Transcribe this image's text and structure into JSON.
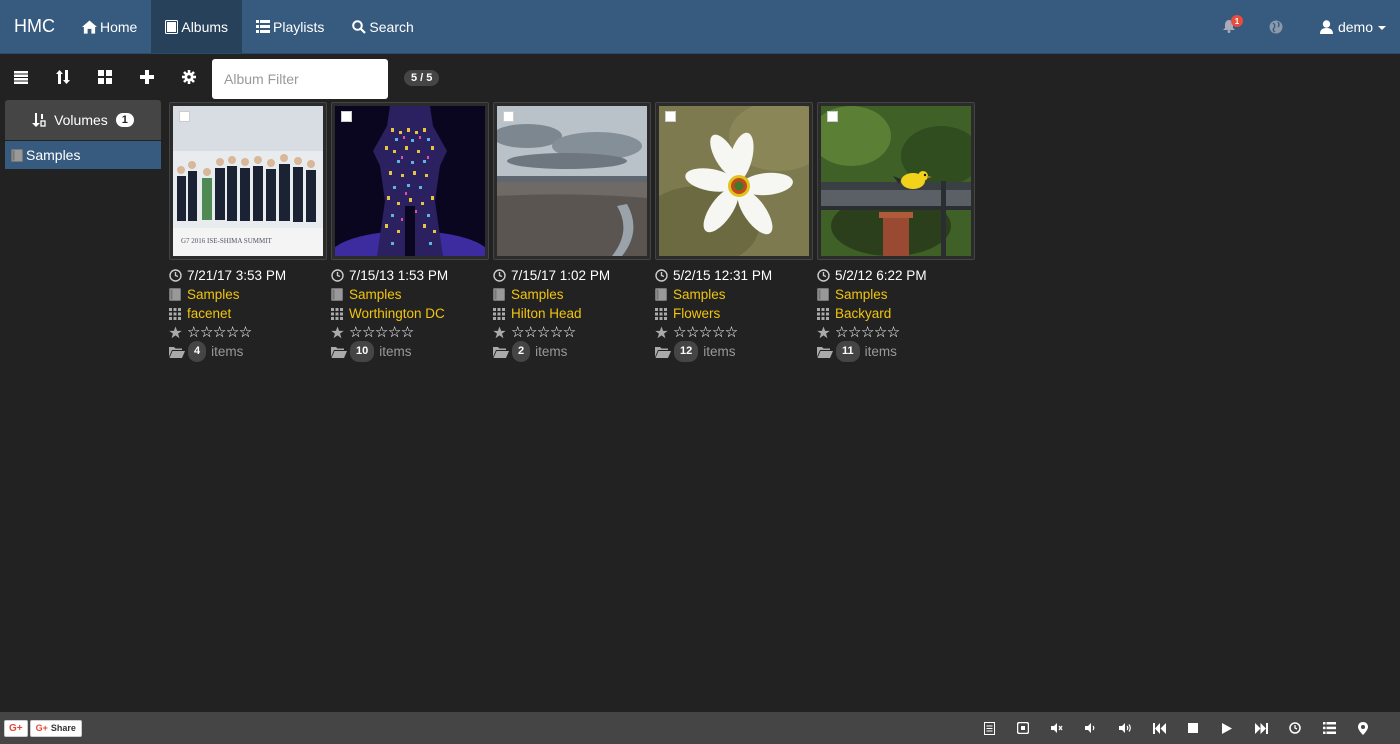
{
  "navbar": {
    "brand": "HMC",
    "items": [
      {
        "label": "Home",
        "icon": "home-icon"
      },
      {
        "label": "Albums",
        "icon": "album-icon",
        "active": true
      },
      {
        "label": "Playlists",
        "icon": "list-icon"
      },
      {
        "label": "Search",
        "icon": "search-icon"
      }
    ],
    "notifications": "1",
    "user": "demo"
  },
  "toolbar": {
    "filter_placeholder": "Album Filter",
    "count": "5 / 5"
  },
  "sidebar": {
    "header": "Volumes",
    "volume_count": "1",
    "volumes": [
      {
        "label": "Samples"
      }
    ]
  },
  "albums": [
    {
      "date": "7/21/17 3:53 PM",
      "volume": "Samples",
      "name": "facenet",
      "stars": "☆☆☆☆☆",
      "count": "4",
      "items_label": "items"
    },
    {
      "date": "7/15/13 1:53 PM",
      "volume": "Samples",
      "name": "Worthington DC",
      "stars": "☆☆☆☆☆",
      "count": "10",
      "items_label": "items"
    },
    {
      "date": "7/15/17 1:02 PM",
      "volume": "Samples",
      "name": "Hilton Head",
      "stars": "☆☆☆☆☆",
      "count": "2",
      "items_label": "items"
    },
    {
      "date": "5/2/15 12:31 PM",
      "volume": "Samples",
      "name": "Flowers",
      "stars": "☆☆☆☆☆",
      "count": "12",
      "items_label": "items"
    },
    {
      "date": "5/2/12 6:22 PM",
      "volume": "Samples",
      "name": "Backyard",
      "stars": "☆☆☆☆☆",
      "count": "11",
      "items_label": "items"
    }
  ],
  "footer": {
    "gplus_label": "G+",
    "share_g": "G+",
    "share_label": "Share"
  },
  "colors": {
    "navbar": "#375a7f",
    "background": "#222222",
    "link": "#f1c40f",
    "badge": "#464545"
  }
}
